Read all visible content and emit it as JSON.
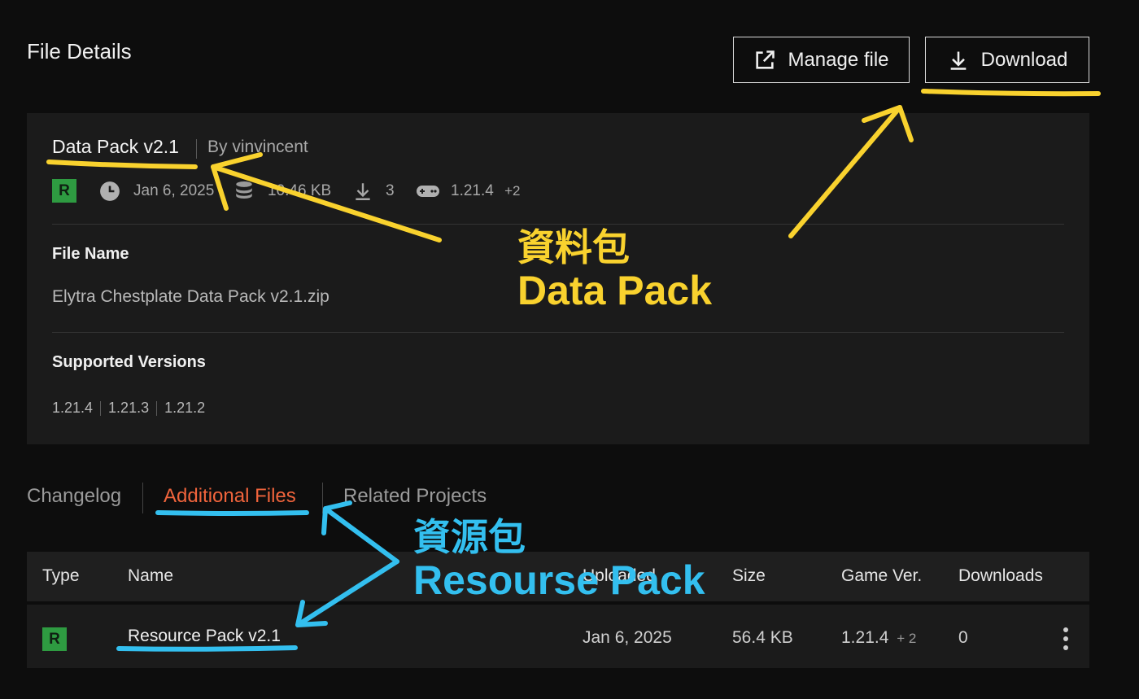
{
  "header": {
    "title": "File Details",
    "manage_label": "Manage file",
    "download_label": "Download"
  },
  "file": {
    "name": "Data Pack v2.1",
    "by_label": "By",
    "author": "vinvincent",
    "release_badge": "R",
    "date": "Jan 6, 2025",
    "size": "10.46 KB",
    "downloads": "3",
    "game_version": "1.21.4",
    "game_version_more": "+2",
    "file_name_label": "File Name",
    "file_name": "Elytra Chestplate Data Pack v2.1.zip",
    "supported_label": "Supported Versions",
    "supported_versions": [
      "1.21.4",
      "1.21.3",
      "1.21.2"
    ]
  },
  "tabs": [
    {
      "label": "Changelog",
      "active": false
    },
    {
      "label": "Additional Files",
      "active": true
    },
    {
      "label": "Related Projects",
      "active": false
    }
  ],
  "table": {
    "columns": [
      "Type",
      "Name",
      "Uploaded",
      "Size",
      "Game Ver.",
      "Downloads"
    ],
    "rows": [
      {
        "type": "R",
        "name": "Resource Pack v2.1",
        "uploaded": "Jan 6, 2025",
        "size": "56.4 KB",
        "game_version": "1.21.4",
        "game_version_more": "+ 2",
        "downloads": "0"
      }
    ]
  },
  "annotations": {
    "yellow_zh": "資料包",
    "yellow_en": "Data Pack",
    "blue_zh": "資源包",
    "blue_en": "Resourse Pack"
  },
  "colors": {
    "background": "#0d0d0d",
    "card": "#1b1b1b",
    "accent_tab": "#f0643c",
    "release_badge": "#2e9b41",
    "annotation_yellow": "#f9d22e",
    "annotation_blue": "#33bfef"
  },
  "icons": {
    "manage": "external-link-icon",
    "download": "download-icon",
    "date": "clock-icon",
    "size": "database-icon",
    "downloads": "download-icon",
    "game_version": "gamepad-icon",
    "row_menu": "kebab-menu-icon"
  }
}
